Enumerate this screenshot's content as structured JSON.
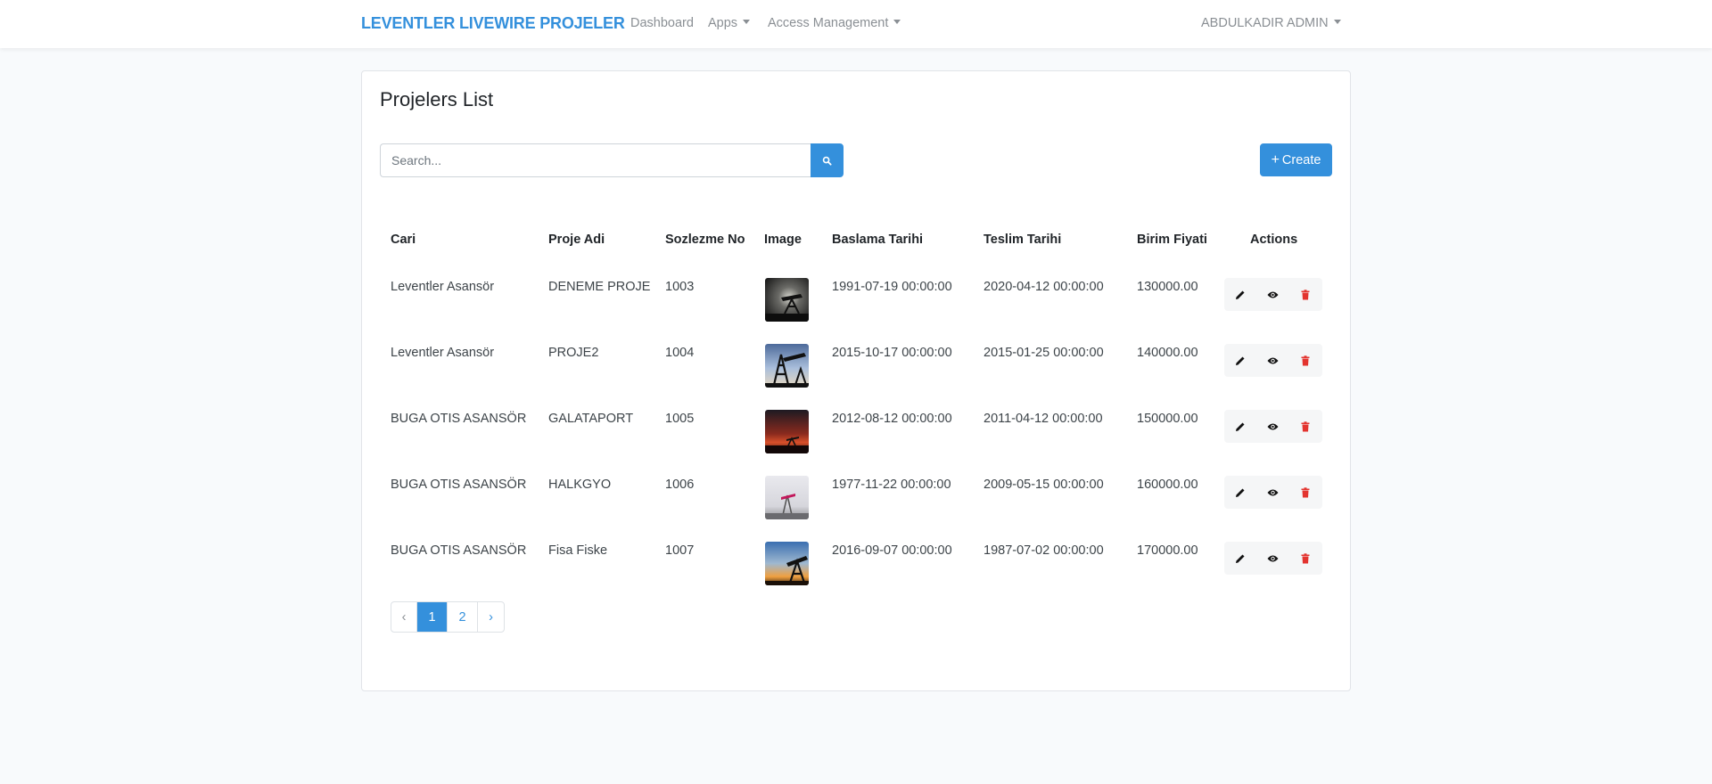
{
  "navbar": {
    "brand": "LEVENTLER LIVEWIRE PROJELER",
    "links": {
      "dashboard": "Dashboard",
      "apps": "Apps",
      "access": "Access Management"
    },
    "user": "ABDULKADIR ADMIN"
  },
  "page": {
    "title": "Projelers List",
    "search_placeholder": "Search...",
    "create_label": "Create"
  },
  "table": {
    "headers": {
      "cari": "Cari",
      "proje_adi": "Proje Adi",
      "sozlezme_no": "Sozlezme No",
      "image": "Image",
      "baslama": "Baslama Tarihi",
      "teslim": "Teslim Tarihi",
      "birim": "Birim Fiyati",
      "actions": "Actions"
    },
    "rows": [
      {
        "cari": "Leventler Asansör",
        "proje_adi": "DENEME PROJE",
        "sozlezme_no": "1003",
        "baslama": "1991-07-19 00:00:00",
        "teslim": "2020-04-12 00:00:00",
        "birim": "130000.00"
      },
      {
        "cari": "Leventler Asansör",
        "proje_adi": "PROJE2",
        "sozlezme_no": "1004",
        "baslama": "2015-10-17 00:00:00",
        "teslim": "2015-01-25 00:00:00",
        "birim": "140000.00"
      },
      {
        "cari": "BUGA OTIS ASANSÖR",
        "proje_adi": "GALATAPORT",
        "sozlezme_no": "1005",
        "baslama": "2012-08-12 00:00:00",
        "teslim": "2011-04-12 00:00:00",
        "birim": "150000.00"
      },
      {
        "cari": "BUGA OTIS ASANSÖR",
        "proje_adi": "HALKGYO",
        "sozlezme_no": "1006",
        "baslama": "1977-11-22 00:00:00",
        "teslim": "2009-05-15 00:00:00",
        "birim": "160000.00"
      },
      {
        "cari": "BUGA OTIS ASANSÖR",
        "proje_adi": "Fisa Fiske",
        "sozlezme_no": "1007",
        "baslama": "2016-09-07 00:00:00",
        "teslim": "1987-07-02 00:00:00",
        "birim": "170000.00"
      }
    ]
  },
  "pagination": {
    "prev": "‹",
    "pages": [
      "1",
      "2"
    ],
    "next": "›",
    "current": "1"
  },
  "colors": {
    "accent": "#3490dc",
    "delete": "#e3342f",
    "background": "#f8fafc"
  }
}
